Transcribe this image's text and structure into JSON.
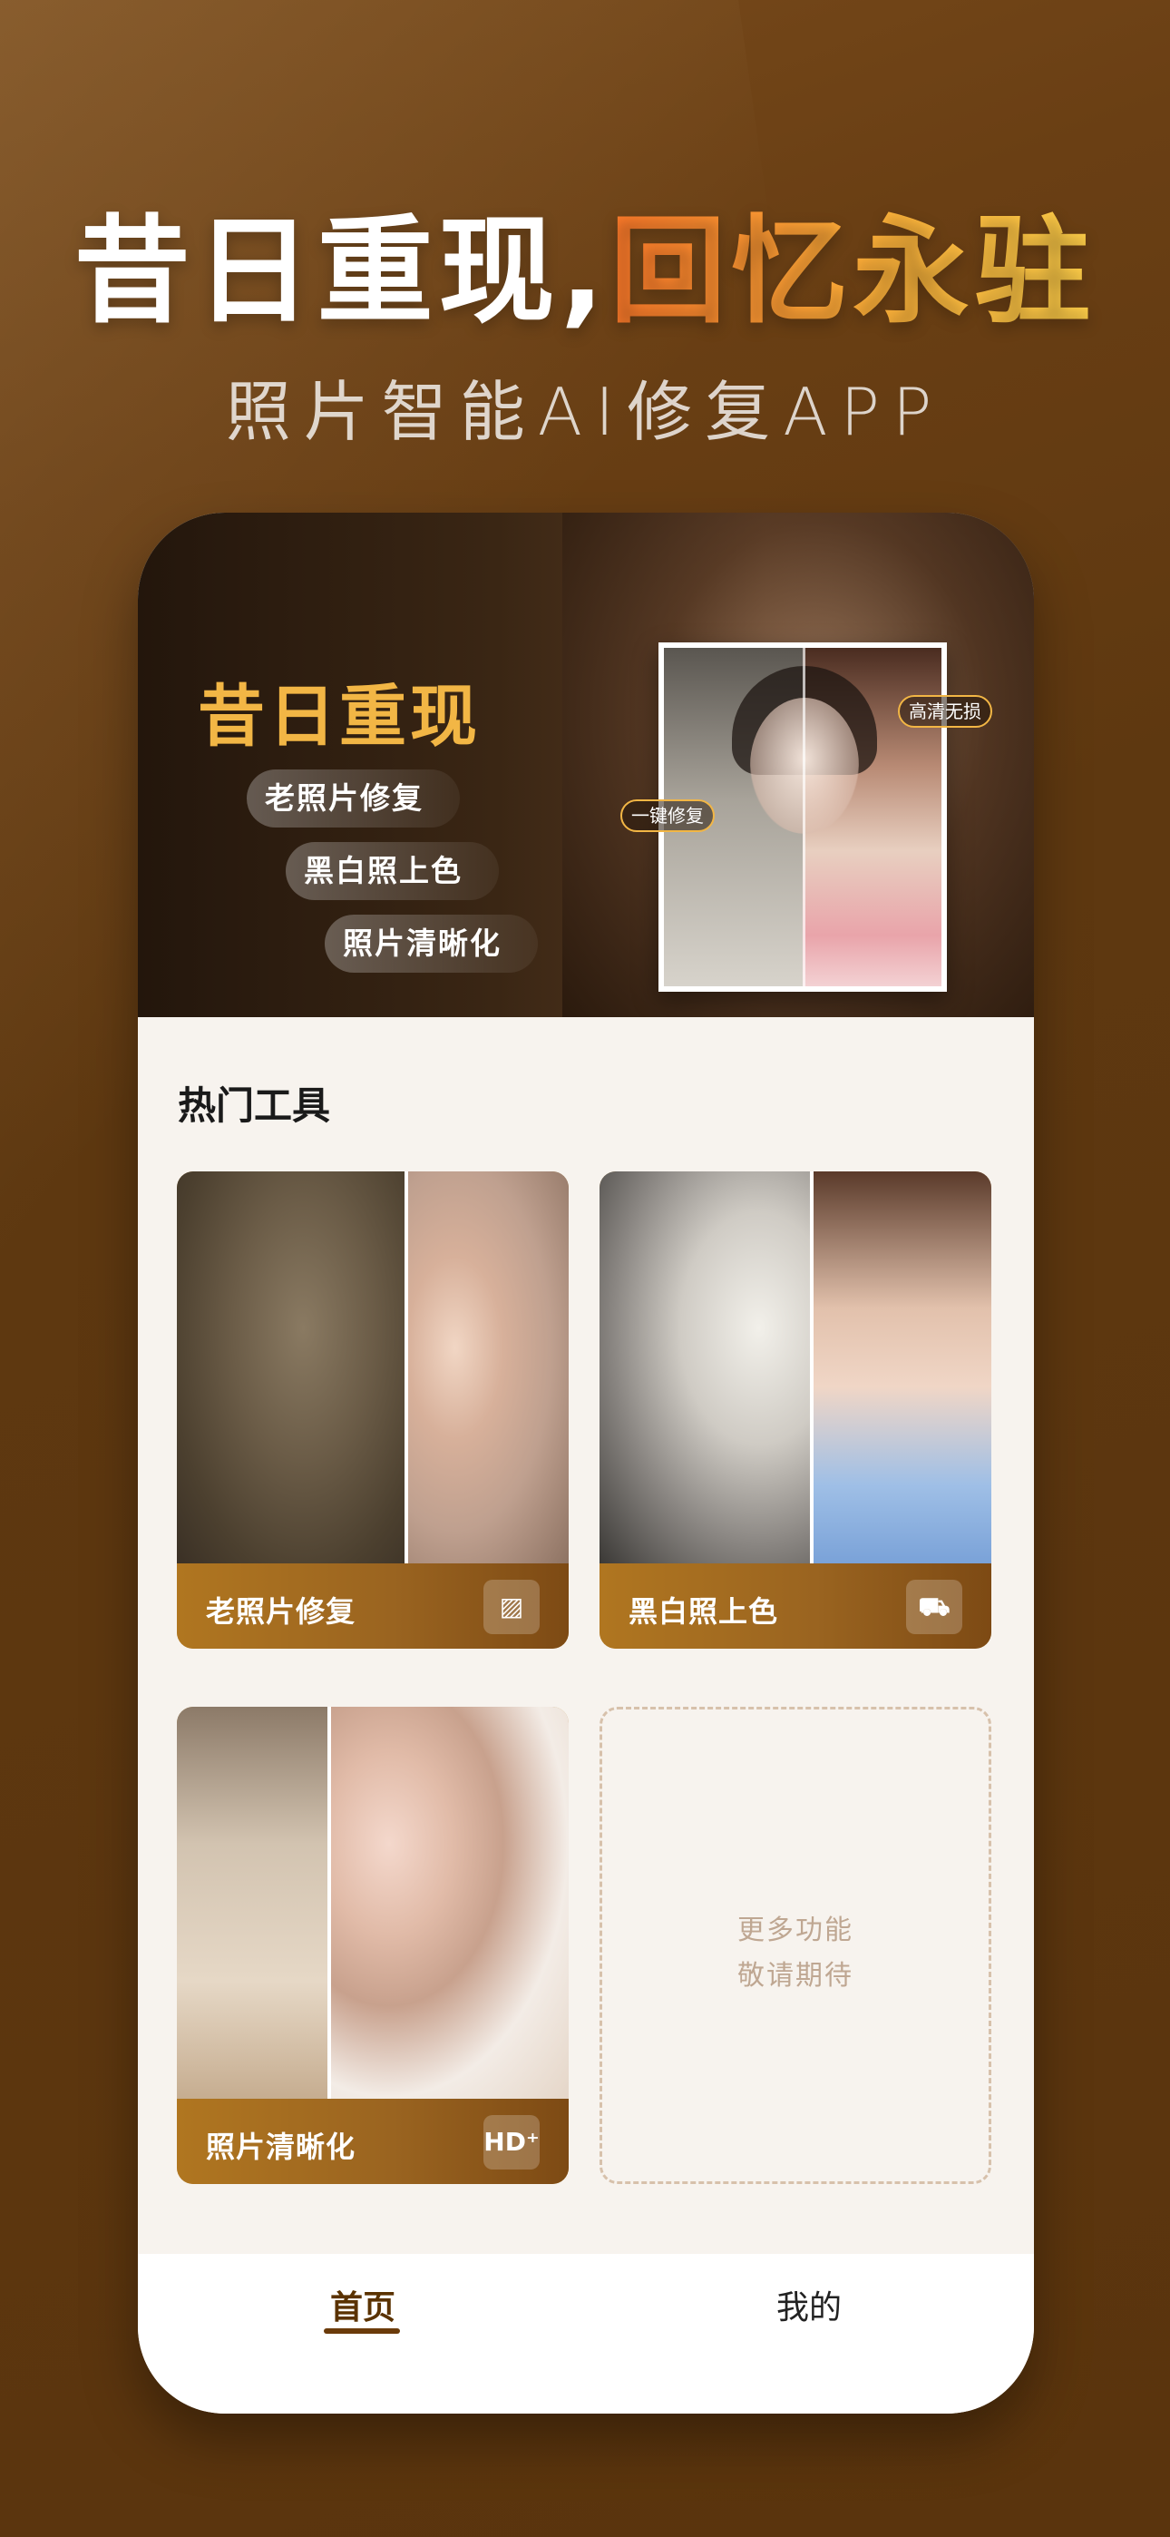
{
  "headline": {
    "white_part": "昔日重现,",
    "accent_part": "回忆永驻"
  },
  "subheadline": "照片智能AI修复APP",
  "banner": {
    "title": "昔日重现",
    "features": [
      "老照片修复",
      "黑白照上色",
      "照片清晰化"
    ],
    "tag_left": "一键修复",
    "tag_right": "高清无损"
  },
  "hot_tools": {
    "title": "热门工具",
    "items": [
      {
        "label": "老照片修复",
        "icon": "photo-restore-icon",
        "icon_glyph": "▨"
      },
      {
        "label": "黑白照上色",
        "icon": "paint-bucket-icon",
        "icon_glyph": "⛟"
      },
      {
        "label": "照片清晰化",
        "icon": "hd-icon",
        "icon_glyph": "HD⁺"
      }
    ],
    "more": {
      "line1": "更多功能",
      "line2": "敬请期待"
    }
  },
  "tabbar": {
    "home": "首页",
    "mine": "我的"
  },
  "colors": {
    "accent": "#f2b645",
    "brand_brown": "#6b3b0a",
    "card_bar": "#a86e20"
  }
}
